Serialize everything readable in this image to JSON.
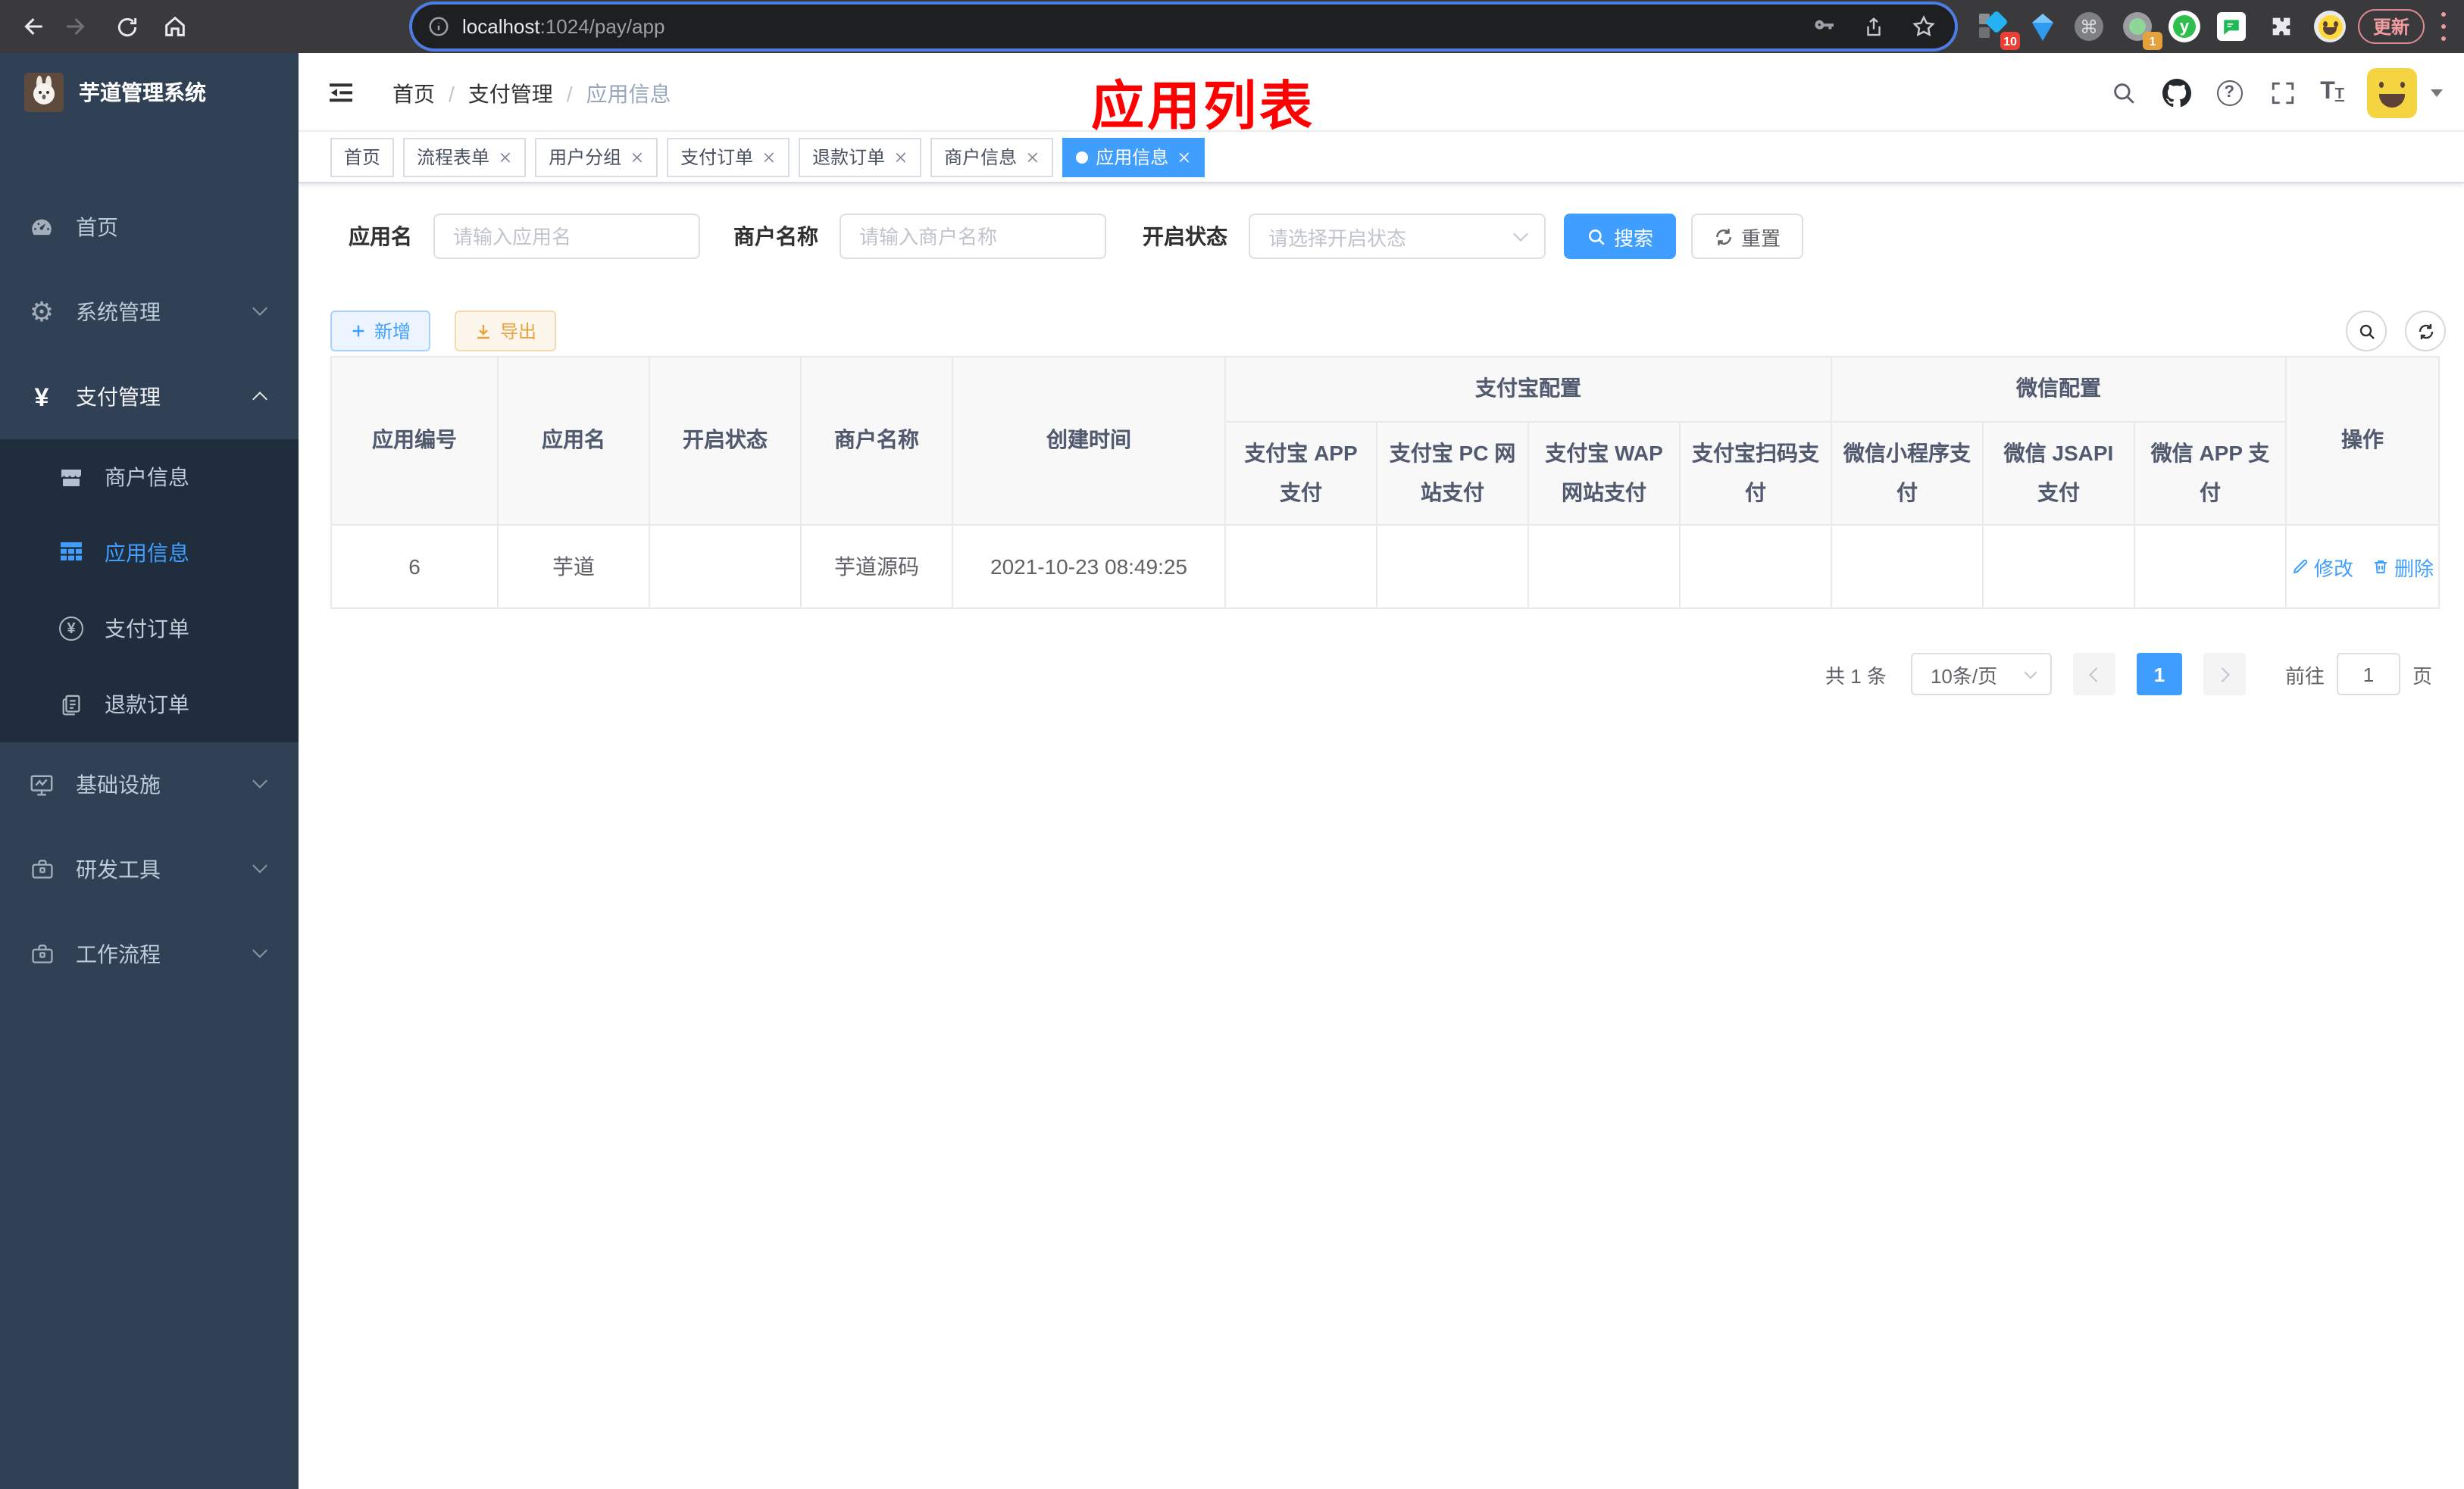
{
  "browser": {
    "url_host": "localhost",
    "url_path": ":1024/pay/app",
    "update_button": "更新",
    "ext_badge_count": "10",
    "ext_badge_count2": "1",
    "ext_letter_y": "y"
  },
  "icons": {
    "question_mark": "?",
    "yen": "¥",
    "gear": "⚙",
    "command": "⌘",
    "font_large": "T",
    "font_small": "T"
  },
  "sidebar": {
    "title": "芋道管理系统",
    "items": [
      {
        "label": "首页"
      },
      {
        "label": "系统管理"
      },
      {
        "label": "支付管理"
      },
      {
        "label": "商户信息"
      },
      {
        "label": "应用信息"
      },
      {
        "label": "支付订单"
      },
      {
        "label": "退款订单"
      },
      {
        "label": "基础设施"
      },
      {
        "label": "研发工具"
      },
      {
        "label": "工作流程"
      }
    ]
  },
  "navbar": {
    "breadcrumb": [
      "首页",
      "支付管理",
      "应用信息"
    ],
    "separator": "/",
    "annotation": "应用列表"
  },
  "tags": [
    {
      "label": "首页"
    },
    {
      "label": "流程表单"
    },
    {
      "label": "用户分组"
    },
    {
      "label": "支付订单"
    },
    {
      "label": "退款订单"
    },
    {
      "label": "商户信息"
    },
    {
      "label": "应用信息"
    }
  ],
  "filters": {
    "app_name_label": "应用名",
    "app_name_placeholder": "请输入应用名",
    "merchant_label": "商户名称",
    "merchant_placeholder": "请输入商户名称",
    "status_label": "开启状态",
    "status_placeholder": "请选择开启状态",
    "search_button": "搜索",
    "reset_button": "重置"
  },
  "toolbar": {
    "add_button": "新增",
    "export_button": "导出"
  },
  "table": {
    "headers": {
      "app_id": "应用编号",
      "app_name": "应用名",
      "status": "开启状态",
      "merchant": "商户名称",
      "created": "创建时间",
      "alipay_group": "支付宝配置",
      "wechat_group": "微信配置",
      "actions": "操作",
      "sub": [
        "支付宝 APP 支付",
        "支付宝 PC 网站支付",
        "支付宝 WAP 网站支付",
        "支付宝扫码支付",
        "微信小程序支付",
        "微信 JSAPI 支付",
        "微信 APP 支付"
      ]
    },
    "row": {
      "app_id": "6",
      "app_name": "芋道",
      "enabled": true,
      "merchant": "芋道源码",
      "created": "2021-10-23 08:49:25",
      "statuses": [
        "no",
        "no",
        "no",
        "no",
        "no",
        "yes",
        "no"
      ],
      "edit_label": "修改",
      "delete_label": "删除"
    }
  },
  "pagination": {
    "total": "共 1 条",
    "page_size": "10条/页",
    "current_page": "1",
    "goto_label": "前往",
    "goto_value": "1",
    "goto_suffix": "页"
  },
  "colors": {
    "primary_blue": "#409eff",
    "sidebar_bg": "#304156",
    "submenu_bg": "#1f2d3d",
    "danger_red": "#f5484d",
    "success_green": "#23b85c",
    "annotation_red": "#ff0000",
    "warning_orange": "#e6a23c"
  }
}
